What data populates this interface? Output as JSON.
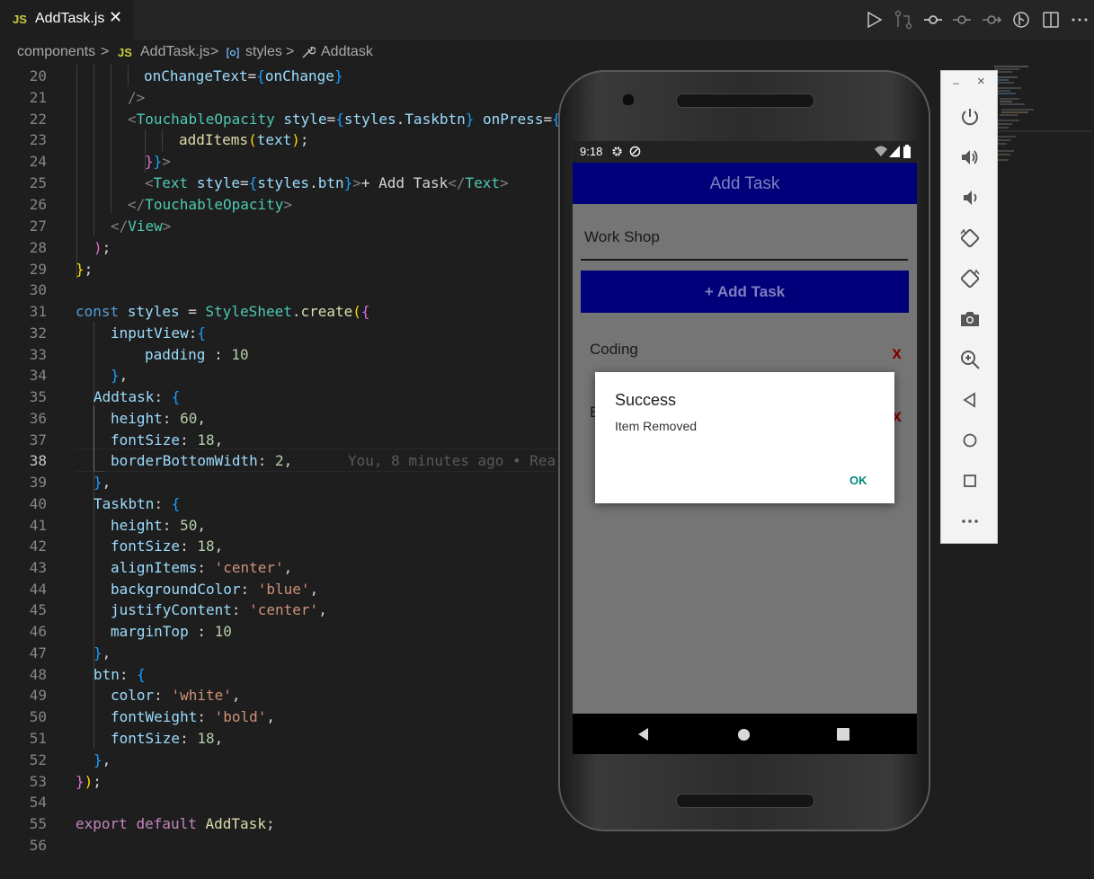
{
  "tab": {
    "badge": "JS",
    "title": "AddTask.js",
    "close": "✕"
  },
  "breadcrumb": {
    "folder": "components",
    "sep": ">",
    "file_badge": "JS",
    "file": "AddTask.js",
    "styles": "styles",
    "symbol": "Addtask"
  },
  "code_lines": [
    {
      "n": "20"
    },
    {
      "n": "21"
    },
    {
      "n": "22"
    },
    {
      "n": "23"
    },
    {
      "n": "24"
    },
    {
      "n": "25"
    },
    {
      "n": "26"
    },
    {
      "n": "27"
    },
    {
      "n": "28"
    },
    {
      "n": "29"
    },
    {
      "n": "30"
    },
    {
      "n": "31"
    },
    {
      "n": "32"
    },
    {
      "n": "33"
    },
    {
      "n": "34"
    },
    {
      "n": "35"
    },
    {
      "n": "36"
    },
    {
      "n": "37"
    },
    {
      "n": "38"
    },
    {
      "n": "39"
    },
    {
      "n": "40"
    },
    {
      "n": "41"
    },
    {
      "n": "42"
    },
    {
      "n": "43"
    },
    {
      "n": "44"
    },
    {
      "n": "45"
    },
    {
      "n": "46"
    },
    {
      "n": "47"
    },
    {
      "n": "48"
    },
    {
      "n": "49"
    },
    {
      "n": "50"
    },
    {
      "n": "51"
    },
    {
      "n": "52"
    },
    {
      "n": "53"
    },
    {
      "n": "54"
    },
    {
      "n": "55"
    },
    {
      "n": "56"
    }
  ],
  "blame": "You, 8 minutes ago • Rea",
  "phone": {
    "time": "9:18",
    "app_title": "Add Task",
    "input_value": "Work Shop",
    "add_button": "+ Add Task",
    "tasks": [
      {
        "text": "Coding",
        "remove": "x"
      },
      {
        "text": "E",
        "remove": "x"
      }
    ]
  },
  "dialog": {
    "title": "Success",
    "message": "Item Removed",
    "ok": "OK"
  },
  "emu_window": {
    "minimize": "–",
    "close": "×"
  },
  "colors": {
    "app_header": "#00007b",
    "dialog_ok": "#00897b",
    "remove_x": "#800000"
  }
}
